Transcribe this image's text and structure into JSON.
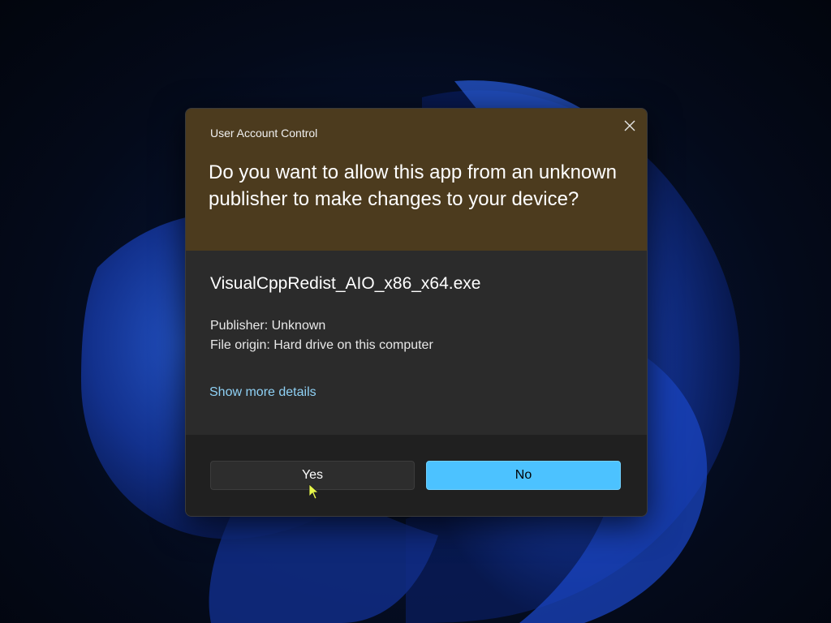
{
  "dialog": {
    "title": "User Account Control",
    "question": "Do you want to allow this app from an unknown publisher to make changes to your device?",
    "app_name": "VisualCppRedist_AIO_x86_x64.exe",
    "publisher": "Publisher: Unknown",
    "file_origin": "File origin: Hard drive on this computer",
    "details_link": "Show more details",
    "close_icon": "close-icon"
  },
  "buttons": {
    "yes_label": "Yes",
    "no_label": "No"
  },
  "colors": {
    "header_bg": "#4c3b1e",
    "body_bg": "#2b2b2b",
    "footer_bg": "#202020",
    "accent": "#4cc2ff",
    "link": "#8fd1f5"
  }
}
